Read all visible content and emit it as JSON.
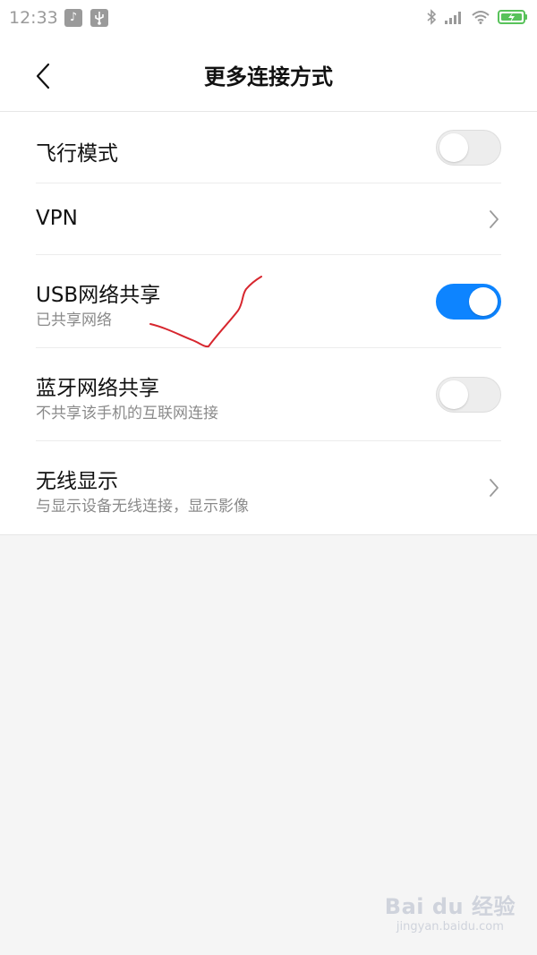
{
  "status_bar": {
    "time": "12:33",
    "icons": [
      "tiktok-icon",
      "usb-icon",
      "bluetooth-icon",
      "cellular-signal-icon",
      "wifi-icon",
      "battery-charging-icon"
    ]
  },
  "header": {
    "title": "更多连接方式",
    "back_icon": "back-arrow-icon"
  },
  "settings": {
    "airplane_mode": {
      "title": "飞行模式",
      "enabled": false
    },
    "vpn": {
      "title": "VPN"
    },
    "usb_tethering": {
      "title": "USB网络共享",
      "subtitle": "已共享网络",
      "enabled": true
    },
    "bluetooth_tethering": {
      "title": "蓝牙网络共享",
      "subtitle": "不共享该手机的互联网连接",
      "enabled": false
    },
    "wireless_display": {
      "title": "无线显示",
      "subtitle": "与显示设备无线连接，显示影像"
    }
  },
  "colors": {
    "toggle_on": "#0d84ff",
    "toggle_off": "#ededed",
    "annotation": "#d7262e"
  },
  "watermark": {
    "logo": "Bai du 经验",
    "url": "jingyan.baidu.com"
  }
}
